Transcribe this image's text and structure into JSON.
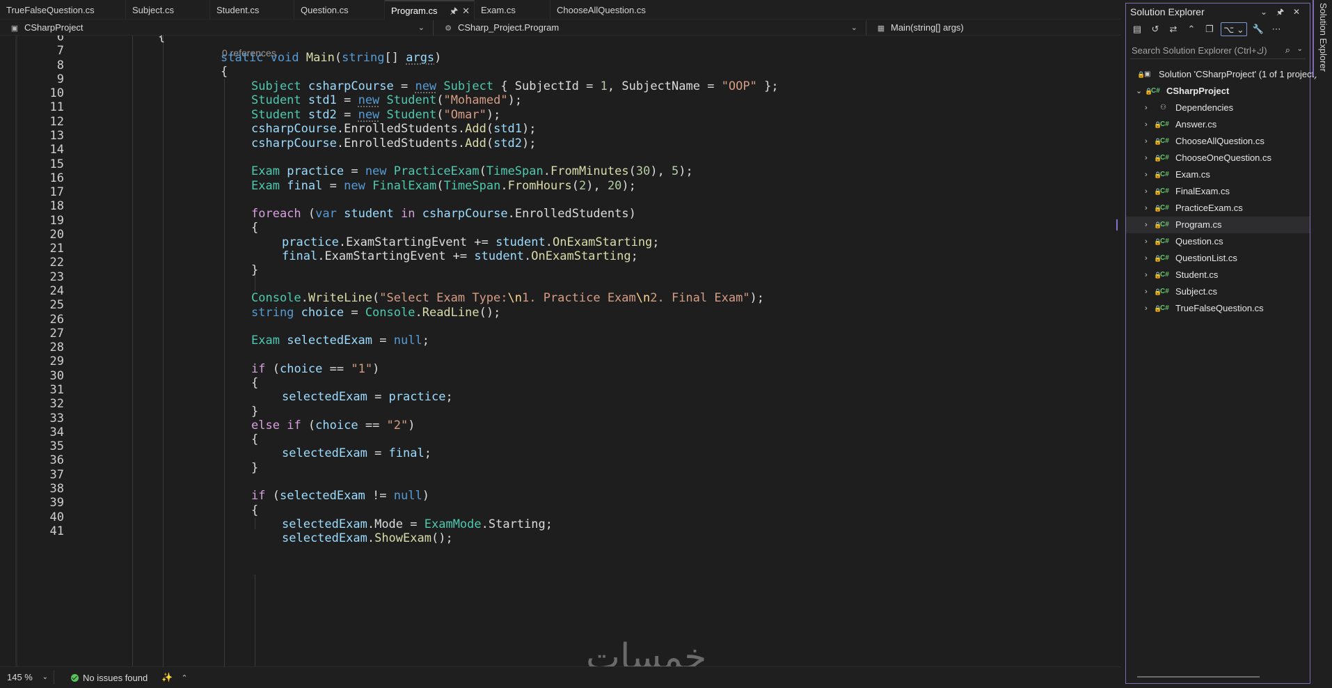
{
  "tabs": [
    {
      "label": "TrueFalseQuestion.cs",
      "active": false
    },
    {
      "label": "Subject.cs",
      "active": false
    },
    {
      "label": "Student.cs",
      "active": false
    },
    {
      "label": "Question.cs",
      "active": false
    },
    {
      "label": "Program.cs",
      "active": true
    },
    {
      "label": "Exam.cs",
      "active": false
    },
    {
      "label": "ChooseAllQuestion.cs",
      "active": false
    }
  ],
  "navbar": {
    "project": "CSharpProject",
    "type": "CSharp_Project.Program",
    "member": "Main(string[] args)"
  },
  "editor": {
    "codelens": "0 references",
    "line_numbers": [
      "6",
      "7",
      "8",
      "9",
      "10",
      "11",
      "12",
      "13",
      "14",
      "15",
      "16",
      "17",
      "18",
      "19",
      "20",
      "21",
      "22",
      "23",
      "24",
      "25",
      "26",
      "27",
      "28",
      "29",
      "30",
      "31",
      "32",
      "33",
      "34",
      "35",
      "36",
      "37",
      "38",
      "39",
      "40",
      "41"
    ],
    "lines": [
      "{",
      "static void Main(string[] args)",
      "{",
      "Subject csharpCourse = new Subject { SubjectId = 1, SubjectName = \"OOP\" };",
      "Student std1 = new Student(\"Mohamed\");",
      "Student std2 = new Student(\"Omar\");",
      "csharpCourse.EnrolledStudents.Add(std1);",
      "csharpCourse.EnrolledStudents.Add(std2);",
      "",
      "Exam practice = new PracticeExam(TimeSpan.FromMinutes(30), 5);",
      "Exam final = new FinalExam(TimeSpan.FromHours(2), 20);",
      "",
      "foreach (var student in csharpCourse.EnrolledStudents)",
      "{",
      "practice.ExamStartingEvent += student.OnExamStarting;",
      "final.ExamStartingEvent += student.OnExamStarting;",
      "}",
      "",
      "Console.WriteLine(\"Select Exam Type:\\n1. Practice Exam\\n2. Final Exam\");",
      "string choice = Console.ReadLine();",
      "",
      "Exam selectedExam = null;",
      "",
      "if (choice == \"1\")",
      "{",
      "selectedExam = practice;",
      "}",
      "else if (choice == \"2\")",
      "{",
      "selectedExam = final;",
      "}",
      "",
      "if (selectedExam != null)",
      "{",
      "selectedExam.Mode = ExamMode.Starting;",
      "selectedExam.ShowExam();"
    ]
  },
  "watermark": "خمسات",
  "statusbar": {
    "zoom": "145 %",
    "issues": "No issues found"
  },
  "solution_explorer": {
    "title": "Solution Explorer",
    "search_placeholder": "Search Solution Explorer (Ctrl+ك)",
    "solution": "Solution 'CSharpProject' (1 of 1 project)",
    "project": "CSharpProject",
    "items": [
      {
        "label": "Dependencies",
        "kind": "dependencies"
      },
      {
        "label": "Answer.cs",
        "kind": "cs"
      },
      {
        "label": "ChooseAllQuestion.cs",
        "kind": "cs"
      },
      {
        "label": "ChooseOneQuestion.cs",
        "kind": "cs"
      },
      {
        "label": "Exam.cs",
        "kind": "cs"
      },
      {
        "label": "FinalExam.cs",
        "kind": "cs"
      },
      {
        "label": "PracticeExam.cs",
        "kind": "cs"
      },
      {
        "label": "Program.cs",
        "kind": "cs",
        "selected": true
      },
      {
        "label": "Question.cs",
        "kind": "cs"
      },
      {
        "label": "QuestionList.cs",
        "kind": "cs"
      },
      {
        "label": "Student.cs",
        "kind": "cs"
      },
      {
        "label": "Subject.cs",
        "kind": "cs"
      },
      {
        "label": "TrueFalseQuestion.cs",
        "kind": "cs"
      }
    ],
    "side_tab": "Solution Explorer"
  },
  "colors": {
    "accent": "#7f6ab3",
    "keyword": "#569cd6",
    "control": "#d8a0df",
    "type": "#4ec9b0",
    "method": "#dcdcaa",
    "string": "#d69d85",
    "number": "#b5cea8",
    "ok": "#58c45c"
  }
}
